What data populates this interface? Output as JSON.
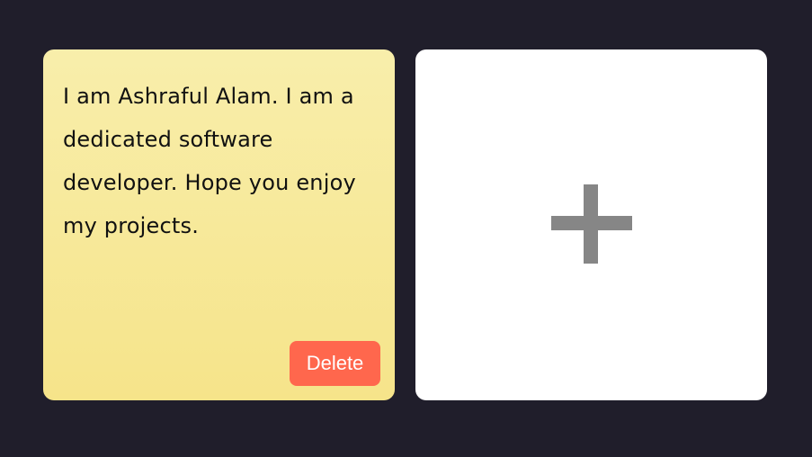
{
  "notes": [
    {
      "text": "I am Ashraful Alam. I am a dedicated software developer. Hope you enjoy my projects.",
      "delete_label": "Delete"
    }
  ],
  "add_card": {
    "icon": "plus-icon"
  },
  "colors": {
    "background": "#201e2b",
    "note_top": "#f8eeab",
    "note_bottom": "#f6e48a",
    "delete_button": "#ff674d",
    "add_card": "#ffffff",
    "plus": "#868686"
  }
}
